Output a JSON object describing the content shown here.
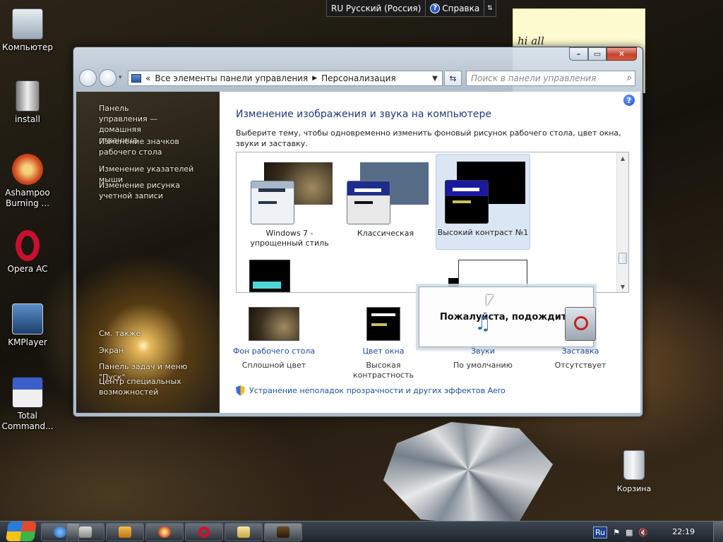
{
  "desktop": {
    "icons": [
      {
        "label": "Компьютер"
      },
      {
        "label": "install"
      },
      {
        "label": "Ashampoo Burning ..."
      },
      {
        "label": "Opera AC"
      },
      {
        "label": "KMPlayer"
      },
      {
        "label": "Total Command..."
      }
    ],
    "recycle_bin": "Корзина",
    "note_text": "hi all"
  },
  "langbar": {
    "language": "RU Русский (Россия)",
    "help": "Справка"
  },
  "window": {
    "breadcrumb": [
      "Все элементы панели управления",
      "Персонализация"
    ],
    "search_placeholder": "Поиск в панели управления",
    "left_links": [
      "Панель управления — домашняя страница",
      "Изменение значков рабочего стола",
      "Изменение указателей мыши",
      "Изменение рисунка учетной записи"
    ],
    "left_see_also": [
      "См. также",
      "Экран",
      "Панель задач и меню \"Пуск\"",
      "Центр специальных возможностей"
    ],
    "heading": "Изменение изображения и звука на компьютере",
    "description": "Выберите тему, чтобы одновременно изменить фоновый рисунок рабочего стола, цвет окна, звуки и заставку.",
    "themes": [
      {
        "name": "Windows 7 - упрощенный стиль"
      },
      {
        "name": "Классическая"
      },
      {
        "name": "Высокий контраст №1"
      }
    ],
    "busy_text": "Пожалуйста, подождите",
    "options": [
      {
        "label": "Фон рабочего стола",
        "value": "Сплошной цвет"
      },
      {
        "label": "Цвет окна",
        "value": "Высокая контрастность"
      },
      {
        "label": "Звуки",
        "value": "По умолчанию"
      },
      {
        "label": "Заставка",
        "value": "Отсутствует"
      }
    ],
    "aero_link": "Устранение неполадок прозрачности и других эффектов Aero"
  },
  "taskbar": {
    "tray_lang": "Ru",
    "clock": "22:19"
  }
}
